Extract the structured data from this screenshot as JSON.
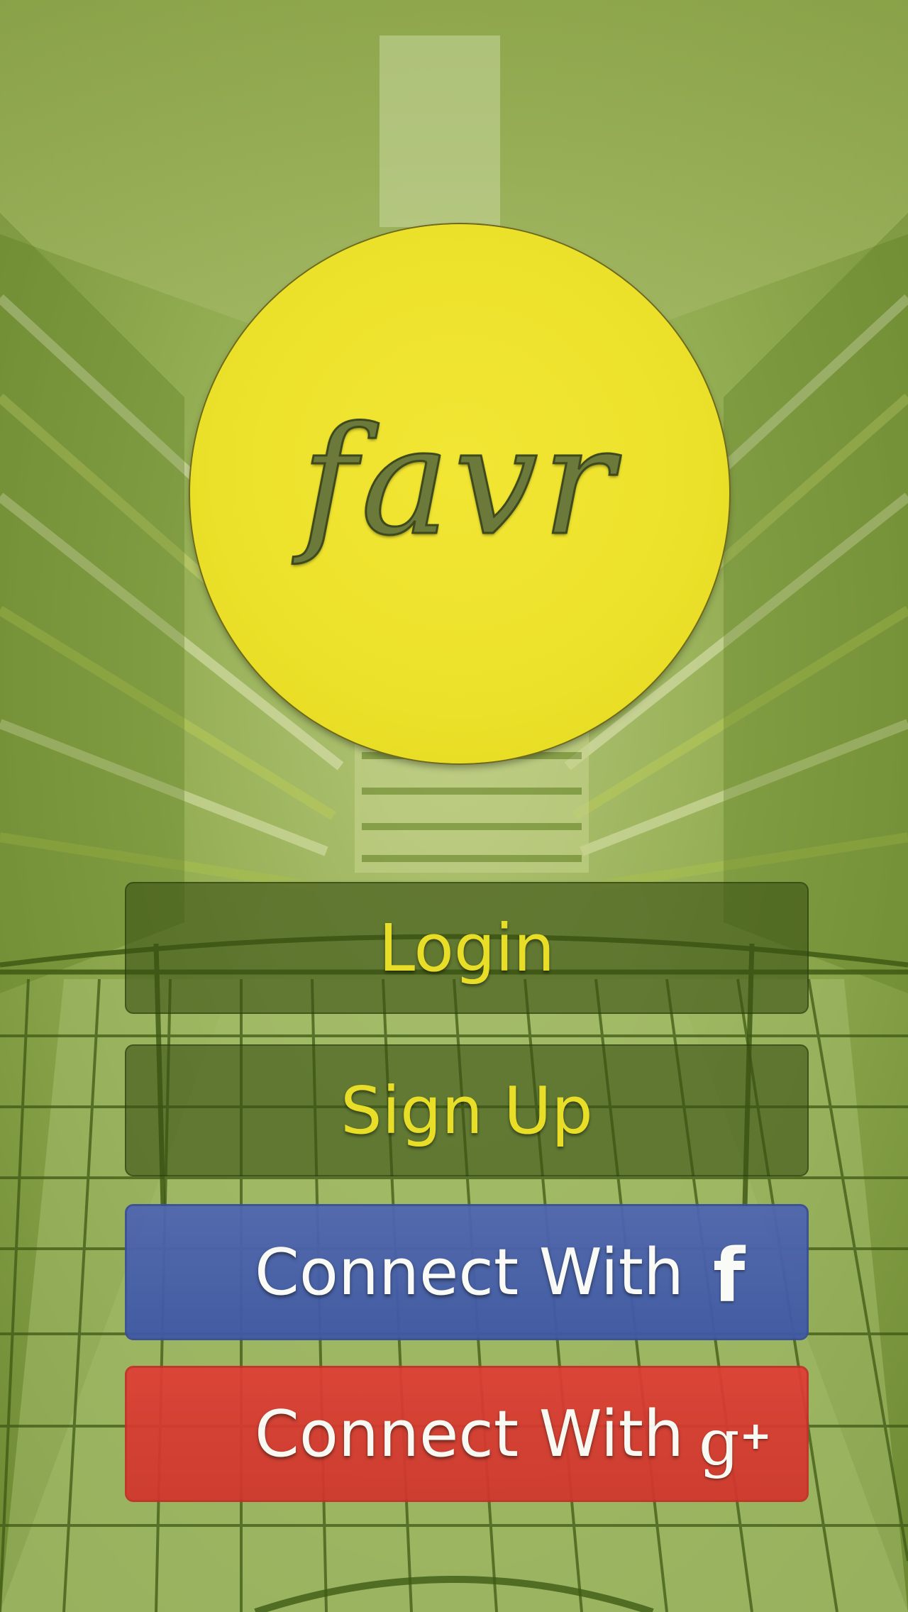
{
  "app": {
    "logo_text": "favr"
  },
  "buttons": {
    "login_label": "Login",
    "signup_label": "Sign Up",
    "facebook_label": "Connect With",
    "google_label": "Connect With"
  },
  "icons": {
    "facebook": {
      "name": "facebook-icon",
      "glyph": "f"
    },
    "google_plus": {
      "name": "google-plus-icon",
      "glyph": "g",
      "plus": "+"
    }
  },
  "colors": {
    "logo_yellow": "#ece12a",
    "button_text_yellow": "#e8de27",
    "overlay_green": "#7f9a43",
    "facebook_blue": "#4760ab",
    "google_red": "#d8382f"
  }
}
